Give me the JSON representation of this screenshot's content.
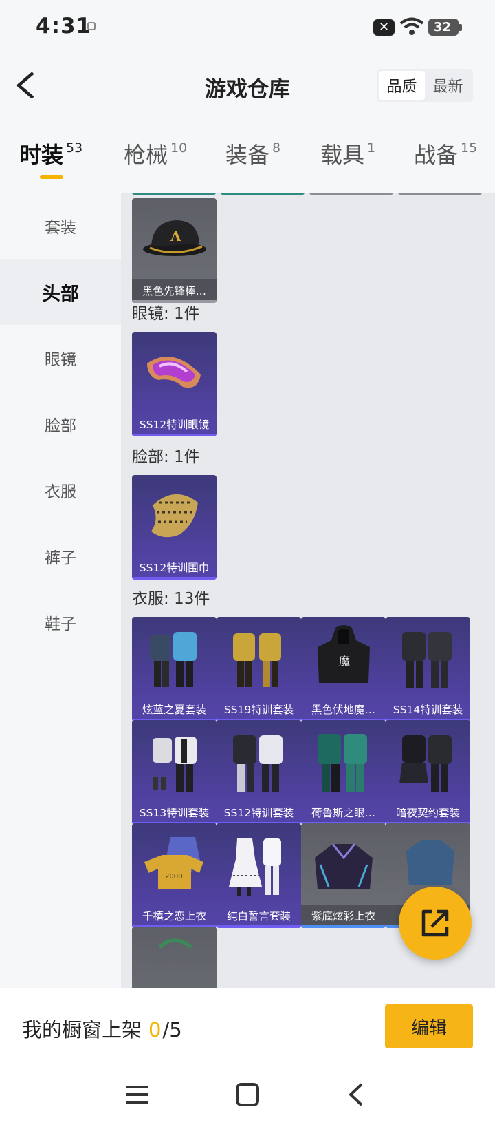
{
  "status_bar": {
    "time": "4:31",
    "battery": "32"
  },
  "header": {
    "title": "游戏仓库",
    "sort_options": [
      "品质",
      "最新"
    ]
  },
  "tabs": [
    {
      "label": "时装",
      "count": "53"
    },
    {
      "label": "枪械",
      "count": "10"
    },
    {
      "label": "装备",
      "count": "8"
    },
    {
      "label": "载具",
      "count": "1"
    },
    {
      "label": "战备",
      "count": "15"
    }
  ],
  "sidebar": {
    "items": [
      "套装",
      "头部",
      "眼镜",
      "脸部",
      "衣服",
      "裤子",
      "鞋子"
    ],
    "active": "头部"
  },
  "content": {
    "head_items": [
      "黑色先锋棒…"
    ],
    "glasses": {
      "title": "眼镜: 1件",
      "items": [
        "SS12特训眼镜"
      ]
    },
    "face": {
      "title": "脸部: 1件",
      "items": [
        "SS12特训围巾"
      ]
    },
    "clothes": {
      "title": "衣服: 13件",
      "items": [
        "炫蓝之夏套装",
        "SS19特训套装",
        "黑色伏地魔…",
        "SS14特训套装",
        "SS13特训套装",
        "SS12特训套装",
        "荷鲁斯之眼…",
        "暗夜契约套装",
        "千禧之恋上衣",
        "纯白誓言套装",
        "紫底炫彩上衣",
        "…"
      ]
    }
  },
  "bottom": {
    "showcase_label": "我的橱窗上架",
    "current": "0",
    "total": "/5",
    "edit_label": "编辑"
  },
  "colors": {
    "accent": "#f5b400",
    "purple_card": "#4b3f96",
    "gray_card": "#6f7178"
  }
}
